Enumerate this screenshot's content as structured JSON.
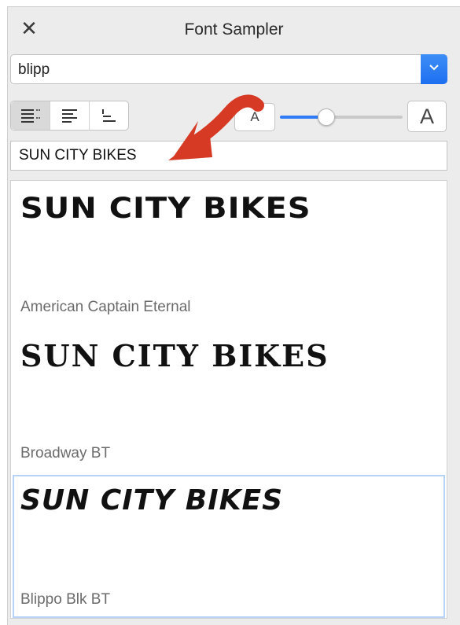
{
  "window": {
    "title": "Font Sampler",
    "close_icon": "close-icon"
  },
  "font_filter": {
    "value": "blipp",
    "arrow_icon": "chevron-down-icon"
  },
  "view_modes": [
    "list-detail-icon",
    "list-lines-icon",
    "list-compact-icon"
  ],
  "size_control": {
    "small_label": "A",
    "large_label": "A",
    "slider_value": 0.38
  },
  "sample_text": "SUN CITY BIKES",
  "annotation": {
    "arrow_color": "#d63a24"
  },
  "accent_color": "#2f7cf6",
  "fonts": [
    {
      "sample": "SUN CITY BIKES",
      "name": "American Captain Eternal",
      "selected": false
    },
    {
      "sample": "SUN CITY BIKES",
      "name": "Broadway BT",
      "selected": false
    },
    {
      "sample": "SUN CITY BIKES",
      "name": "Blippo Blk BT",
      "selected": true
    }
  ]
}
